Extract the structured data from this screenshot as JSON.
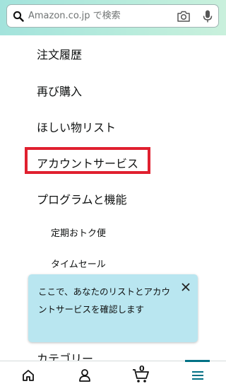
{
  "search": {
    "placeholder": "Amazon.co.jp で検索"
  },
  "menu": {
    "items": [
      {
        "label": "注文履歴"
      },
      {
        "label": "再び購入"
      },
      {
        "label": "ほしい物リスト"
      },
      {
        "label": "アカウントサービス"
      },
      {
        "label": "プログラムと機能"
      }
    ],
    "sub_items": [
      {
        "label": "定期おトク便"
      },
      {
        "label": "タイムセール"
      }
    ],
    "category_label": "カテゴリー"
  },
  "tooltip": {
    "text": "ここで、あなたのリストとアカウントサービスを確認します"
  },
  "bottom_nav": {
    "cart_count": "0",
    "active_tab": "menu",
    "accent_color": "#007185"
  },
  "colors": {
    "highlight": "#e0202f",
    "tooltip_bg": "#b9e6f0"
  },
  "icons": [
    "search-icon",
    "camera-icon",
    "mic-icon",
    "home-icon",
    "account-icon",
    "cart-icon",
    "menu-icon",
    "close-icon"
  ]
}
